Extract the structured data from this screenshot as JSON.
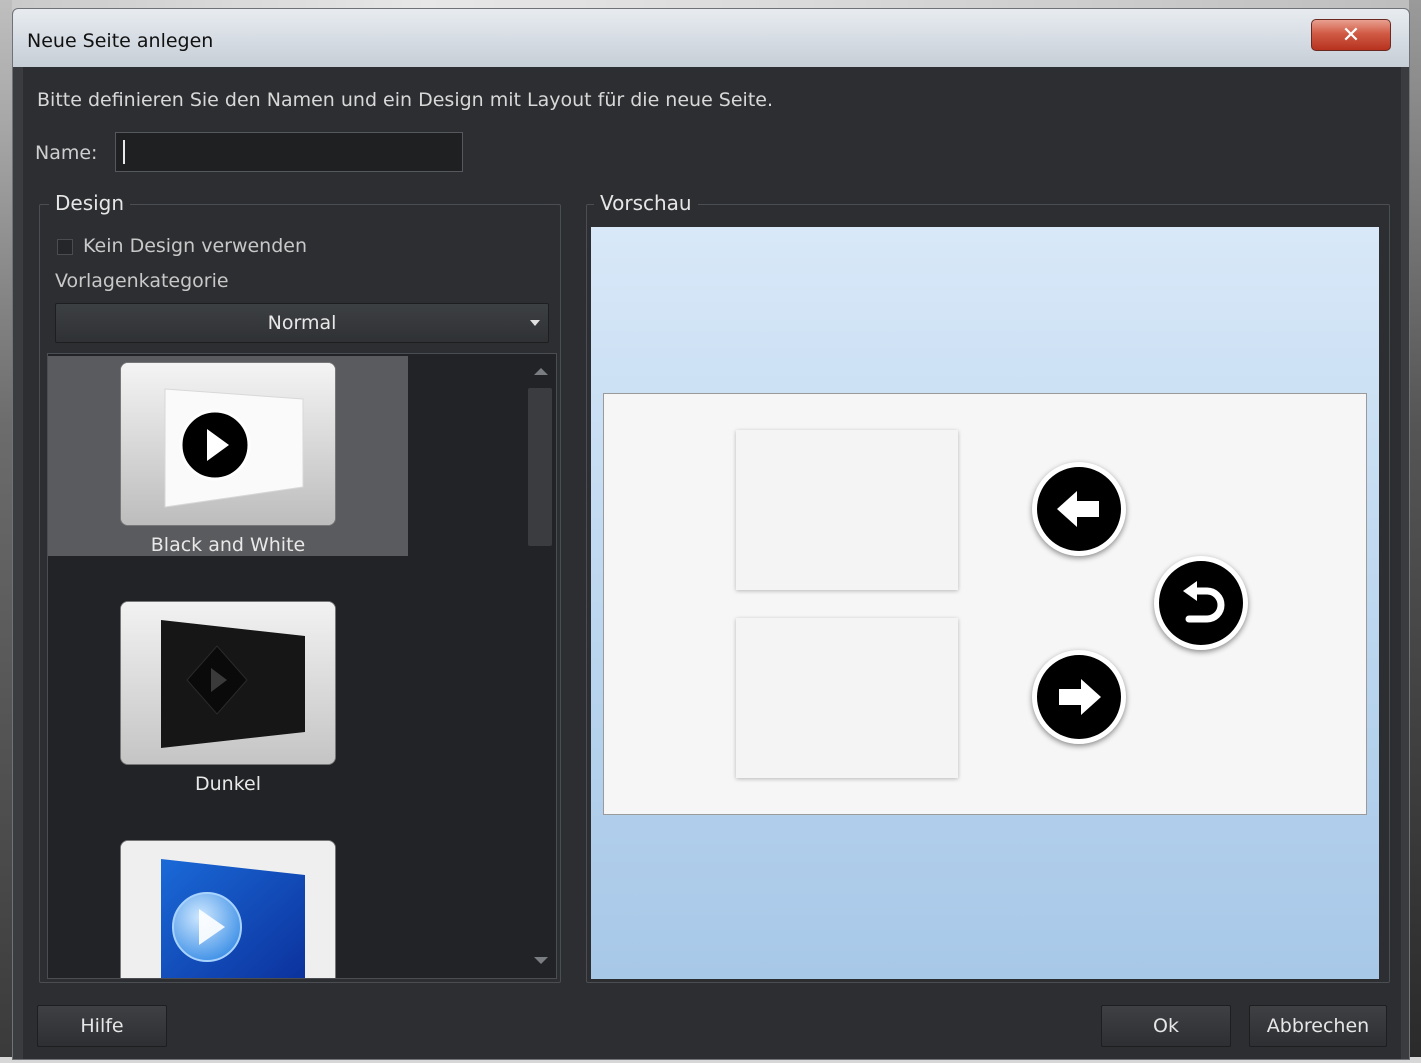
{
  "window": {
    "title": "Neue Seite anlegen",
    "close_glyph": "✕"
  },
  "intro": "Bitte definieren Sie den Namen und ein Design mit Layout für die neue Seite.",
  "name_field": {
    "label": "Name:",
    "value": ""
  },
  "design": {
    "legend": "Design",
    "no_design_label": "Kein Design verwenden",
    "no_design_checked": false,
    "category_label": "Vorlagenkategorie",
    "category_selected": "Normal",
    "templates": [
      {
        "label": "Black and White",
        "selected": true,
        "icon": "play-icon"
      },
      {
        "label": "Dunkel",
        "selected": false,
        "icon": "play-icon"
      },
      {
        "label": "",
        "selected": false,
        "icon": "play-icon"
      }
    ]
  },
  "preview": {
    "legend": "Vorschau",
    "buttons": {
      "back": "arrow-left-icon",
      "home": "return-icon",
      "next": "arrow-right-icon"
    }
  },
  "footer": {
    "help_label": "Hilfe",
    "ok_label": "Ok",
    "cancel_label": "Abbrechen"
  },
  "colors": {
    "dialog_bg": "#2c2e31",
    "selected_item": "#5a5b5e",
    "preview_sky": "#b8d4ee",
    "close_button": "#c8432e"
  }
}
